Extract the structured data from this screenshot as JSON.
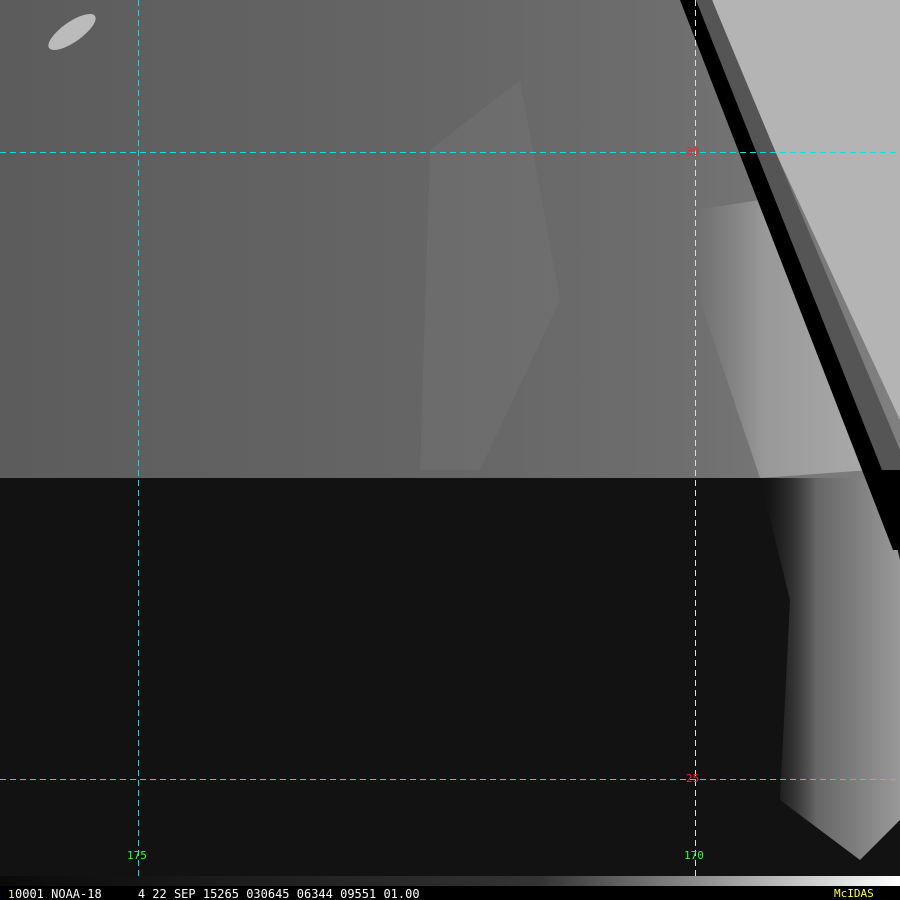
{
  "image": {
    "satellite": "NOAA-18",
    "frame_index": "1",
    "info_line": "0001 NOAA-18     4 22 SEP 15265 030645 06344 09551 01.00",
    "software": "McIDAS"
  },
  "grid": {
    "latitudes": [
      {
        "label": "30"
      },
      {
        "label": "25"
      }
    ],
    "longitudes": [
      {
        "label": "175"
      },
      {
        "label": "170"
      }
    ],
    "line_color": "#00e5e5",
    "lat_label_color": "#ff2020",
    "lon_label_color": "#30ff30"
  },
  "colors": {
    "footer_text": "#ffffff",
    "frame_number": "#ffff30",
    "logo": "#ffff30"
  }
}
